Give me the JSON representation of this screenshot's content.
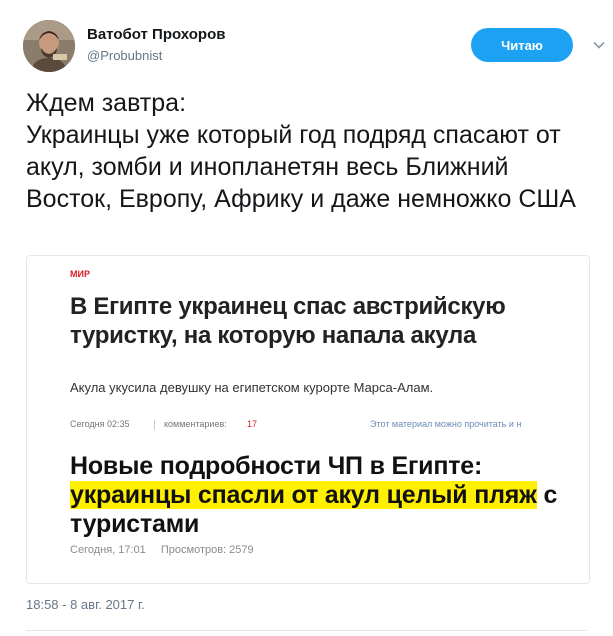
{
  "author": {
    "name": "Ватобот Прохоров",
    "handle": "@Probubnist"
  },
  "follow_button": {
    "label": "Читаю"
  },
  "tweet": {
    "text": "Ждем завтра:\nУкраинцы уже который год подряд спасают от акул, зомби и инопланетян весь Ближний Восток, Европу, Африку и даже немножко США",
    "timestamp": "18:58 - 8 авг. 2017 г."
  },
  "media": {
    "article1": {
      "section": "МИР",
      "headline": "В Египте украинец спас австрийскую туристку, на которую напала акула",
      "lead": "Акула укусила девушку на египетском курорте Марса-Алам.",
      "time": "Сегодня 02:35",
      "comments_label": "комментариев:",
      "comments_count": "17",
      "more_link": "Этот материал можно прочитать и н"
    },
    "article2": {
      "headline_part1": "Новые подробности ЧП в Египте: ",
      "headline_highlight": "украинцы спасли от акул целый пляж",
      "headline_part2": " с туристами",
      "time": "Сегодня, 17:01",
      "views": "Просмотров: 2579"
    }
  },
  "colors": {
    "follow_button_bg": "#1da1f2",
    "section_red": "#d61e2d",
    "highlight_yellow": "#ffef00"
  },
  "icons": {
    "dropdown": "chevron-down-icon"
  }
}
